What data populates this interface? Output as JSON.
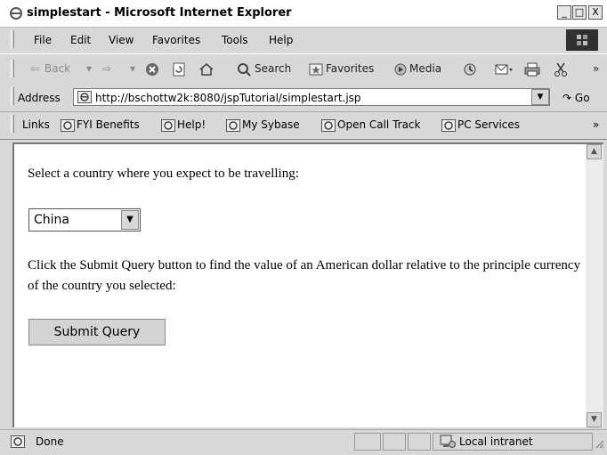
{
  "window": {
    "title": "simplestart - Microsoft Internet Explorer",
    "buttons": [
      "_",
      "□",
      "X"
    ]
  },
  "menu": [
    "File",
    "Edit",
    "View",
    "Favorites",
    "Tools",
    "Help"
  ],
  "toolbar": {
    "back": "Back",
    "search": "Search",
    "favorites": "Favorites",
    "media": "Media",
    "more": "»"
  },
  "address": {
    "label": "Address",
    "url": "http://bschottw2k:8080/jspTutorial/simplestart.jsp",
    "go": "Go"
  },
  "links": {
    "label": "Links",
    "items": [
      "FYI Benefits",
      "Help!",
      "My Sybase",
      "Open Call Track",
      "PC Services"
    ],
    "more": "»"
  },
  "page": {
    "prompt": "Select a country where you expect to be travelling:",
    "country_selected": "China",
    "instructions": "Click the Submit Query button to find the value of an American dollar relative to the principle currency of the country you selected:",
    "submit_label": "Submit Query"
  },
  "status": {
    "text": "Done",
    "zone": "Local intranet"
  }
}
